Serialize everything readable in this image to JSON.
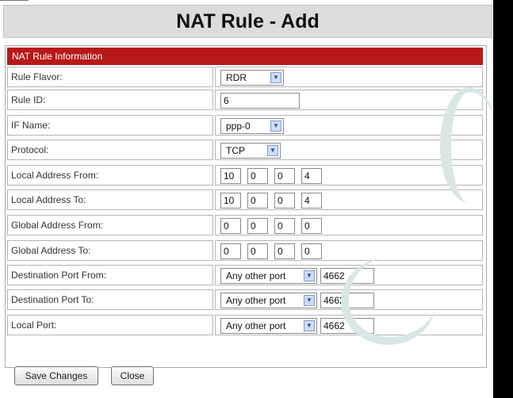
{
  "page": {
    "title": "NAT Rule - Add",
    "section_header": "NAT Rule Information"
  },
  "form": {
    "rule_flavor": {
      "label": "Rule Flavor:",
      "value": "RDR"
    },
    "rule_id": {
      "label": "Rule ID:",
      "value": "6"
    },
    "if_name": {
      "label": "IF Name:",
      "value": "ppp-0"
    },
    "protocol": {
      "label": "Protocol:",
      "value": "TCP"
    },
    "local_address_from": {
      "label": "Local Address From:",
      "octets": [
        "10",
        "0",
        "0",
        "4"
      ]
    },
    "local_address_to": {
      "label": "Local Address To:",
      "octets": [
        "10",
        "0",
        "0",
        "4"
      ]
    },
    "global_address_from": {
      "label": "Global Address From:",
      "octets": [
        "0",
        "0",
        "0",
        "0"
      ]
    },
    "global_address_to": {
      "label": "Global Address To:",
      "octets": [
        "0",
        "0",
        "0",
        "0"
      ]
    },
    "dest_port_from": {
      "label": "Destination Port From:",
      "select": "Any other port",
      "port": "4662"
    },
    "dest_port_to": {
      "label": "Destination Port To:",
      "select": "Any other port",
      "port": "4662"
    },
    "local_port": {
      "label": "Local Port:",
      "select": "Any other port",
      "port": "4662"
    }
  },
  "buttons": {
    "save": "Save Changes",
    "close": "Close"
  },
  "colors": {
    "header_red": "#b71919",
    "title_bg": "#dcdcdc"
  }
}
